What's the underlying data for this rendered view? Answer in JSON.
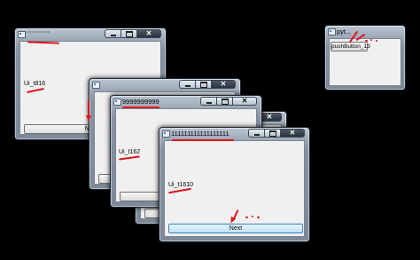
{
  "windows": {
    "w1": {
      "title": "ˇˇˇˇˇˇˇˇˇ",
      "label": "Ui_t816",
      "button": "Next",
      "close": "✕"
    },
    "w2": {
      "close": "✕"
    },
    "w3": {
      "close": "✕"
    },
    "w4": {
      "title": "9999999999",
      "label": "Ui_t162",
      "close": "✕"
    },
    "w5": {
      "title": "111111111111111111",
      "label": "Ui_t1610",
      "button": "Next",
      "close": "✕"
    },
    "w6": {
      "title": "pyt...",
      "button": "pushButton_13"
    }
  },
  "colors": {
    "annotation": "#e0141e",
    "desktop": "#000000"
  },
  "icons": [
    "app-icon",
    "minimize-icon",
    "maximize-icon",
    "close-icon"
  ]
}
